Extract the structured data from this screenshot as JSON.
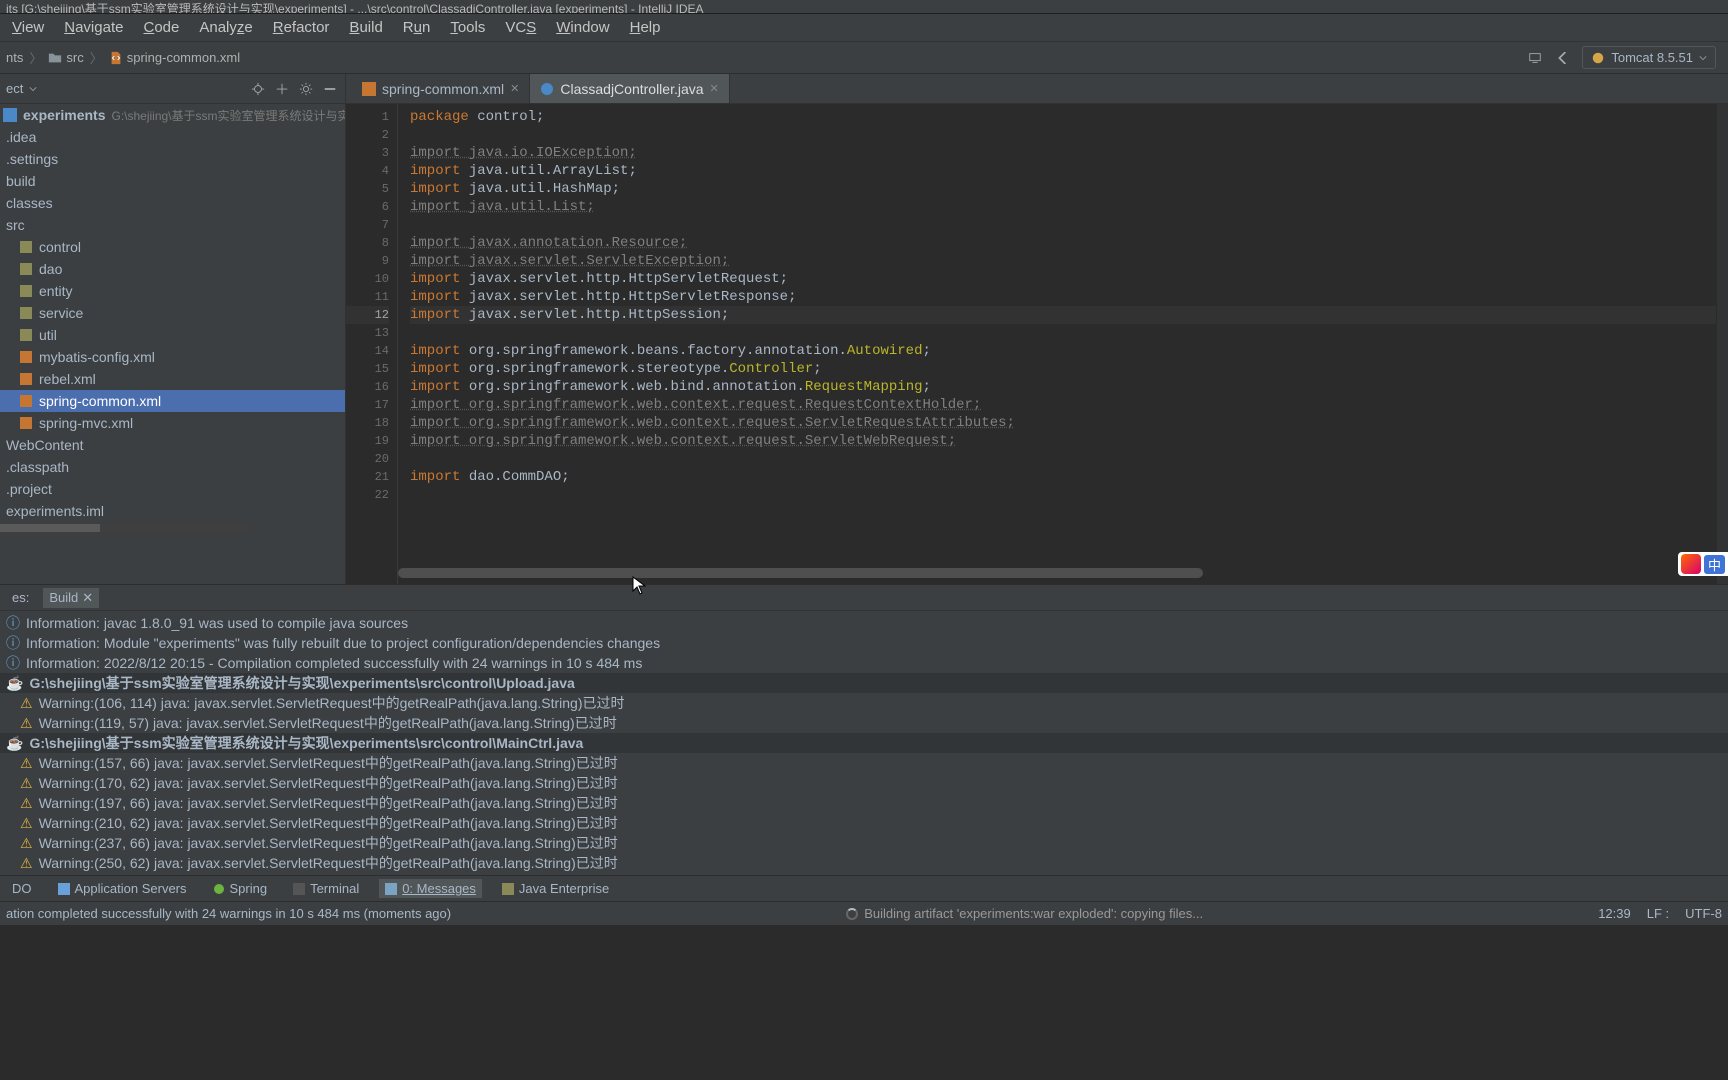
{
  "window_title": "its [G:\\shejiing\\基于ssm实验室管理系统设计与实现\\experiments] - ...\\src\\control\\ClassadjController.java [experiments] - IntelliJ IDEA",
  "menu": {
    "view": "View",
    "view_m": "V",
    "navigate": "Navigate",
    "navigate_m": "N",
    "code": "Code",
    "code_m": "C",
    "analyze": "Analyze",
    "analyze_m": "z",
    "refactor": "Refactor",
    "refactor_m": "R",
    "build": "Build",
    "build_m": "B",
    "run": "Run",
    "run_m": "u",
    "tools": "Tools",
    "tools_m": "T",
    "vcs": "VCS",
    "vcs_m": "S",
    "window": "Window",
    "window_m": "W",
    "help": "Help",
    "help_m": "H"
  },
  "breadcrumbs": {
    "b0": "nts",
    "b1": "src",
    "b2": "spring-common.xml"
  },
  "run_config": {
    "name": "Tomcat 8.5.51"
  },
  "project": {
    "header": "ect",
    "root_name": "experiments",
    "root_path": "G:\\shejiing\\基于ssm实验室管理系统设计与实现\\",
    "items": {
      "idea": ".idea",
      "settings": ".settings",
      "build": "build",
      "classes": "classes",
      "src": "src",
      "control": "control",
      "dao": "dao",
      "entity": "entity",
      "service": "service",
      "util": "util",
      "mybatis": "mybatis-config.xml",
      "rebel": "rebel.xml",
      "springc": "spring-common.xml",
      "springm": "spring-mvc.xml",
      "webcontent": "WebContent",
      "classpath": ".classpath",
      "projectf": ".project",
      "iml": "experiments.iml"
    }
  },
  "tabs": {
    "t0": "spring-common.xml",
    "t1": "ClassadjController.java"
  },
  "code": {
    "line1": {
      "kw": "package ",
      "rest": "control;"
    },
    "line3": {
      "full": "import java.io.IOException;"
    },
    "line4": {
      "kw": "import ",
      "rest": "java.util.ArrayList;"
    },
    "line5": {
      "kw": "import ",
      "rest": "java.util.HashMap;"
    },
    "line6": {
      "full": "import java.util.List;"
    },
    "line8": {
      "full": "import javax.annotation.Resource;"
    },
    "line9": {
      "full": "import javax.servlet.ServletException;"
    },
    "line10": {
      "kw": "import ",
      "rest": "javax.servlet.http.HttpServletRequest;"
    },
    "line11": {
      "kw": "import ",
      "rest": "javax.servlet.http.HttpServletResponse;"
    },
    "line12": {
      "kw": "import ",
      "rest": "javax.servlet.http.HttpSession;"
    },
    "line14": {
      "kw": "import ",
      "mid": "org.springframework.beans.factory.annotation.",
      "cls": "Autowired",
      "end": ";"
    },
    "line15": {
      "kw": "import ",
      "mid": "org.springframework.stereotype.",
      "cls": "Controller",
      "end": ";"
    },
    "line16": {
      "kw": "import ",
      "mid": "org.springframework.web.bind.annotation.",
      "cls": "RequestMapping",
      "end": ";"
    },
    "line17": {
      "full": "import org.springframework.web.context.request.RequestContextHolder;"
    },
    "line18": {
      "full": "import org.springframework.web.context.request.ServletRequestAttributes;"
    },
    "line19": {
      "full": "import org.springframework.web.context.request.ServletWebRequest;"
    },
    "line21": {
      "kw": "import ",
      "rest": "dao.CommDAO;"
    }
  },
  "gutter": [
    "1",
    "2",
    "3",
    "4",
    "5",
    "6",
    "7",
    "8",
    "9",
    "10",
    "11",
    "12",
    "13",
    "14",
    "15",
    "16",
    "17",
    "18",
    "19",
    "20",
    "21",
    "22"
  ],
  "messages": {
    "tab0": "es:",
    "tab1": "Build",
    "info1": "Information: javac 1.8.0_91 was used to compile java sources",
    "info2": "Information: Module \"experiments\" was fully rebuilt due to project configuration/dependencies changes",
    "info3": "Information: 2022/8/12 20:15 - Compilation completed successfully with 24 warnings in 10 s 484 ms",
    "hdr1": "G:\\shejiing\\基于ssm实验室管理系统设计与实现\\experiments\\src\\control\\Upload.java",
    "w1": "Warning:(106, 114)  java: javax.servlet.ServletRequest中的getRealPath(java.lang.String)已过时",
    "w2": "Warning:(119, 57)  java: javax.servlet.ServletRequest中的getRealPath(java.lang.String)已过时",
    "hdr2": "G:\\shejiing\\基于ssm实验室管理系统设计与实现\\experiments\\src\\control\\MainCtrl.java",
    "w3": "Warning:(157, 66)  java: javax.servlet.ServletRequest中的getRealPath(java.lang.String)已过时",
    "w4": "Warning:(170, 62)  java: javax.servlet.ServletRequest中的getRealPath(java.lang.String)已过时",
    "w5": "Warning:(197, 66)  java: javax.servlet.ServletRequest中的getRealPath(java.lang.String)已过时",
    "w6": "Warning:(210, 62)  java: javax.servlet.ServletRequest中的getRealPath(java.lang.String)已过时",
    "w7": "Warning:(237, 66)  java: javax.servlet.ServletRequest中的getRealPath(java.lang.String)已过时",
    "w8": "Warning:(250, 62)  java: javax.servlet.ServletRequest中的getRealPath(java.lang.String)已过时"
  },
  "toolwindows": {
    "todo": "DO",
    "appserv": "Application Servers",
    "spring": "Spring",
    "terminal": "Terminal",
    "messages": "0: Messages",
    "javaee": "Java Enterprise"
  },
  "status": {
    "left": "ation completed successfully with 24 warnings in 10 s 484 ms (moments ago)",
    "mid": "Building artifact 'experiments:war exploded': copying files...",
    "pos": "12:39",
    "sep": "LF :",
    "enc": "UTF-8"
  },
  "ime": {
    "lang": "中"
  }
}
